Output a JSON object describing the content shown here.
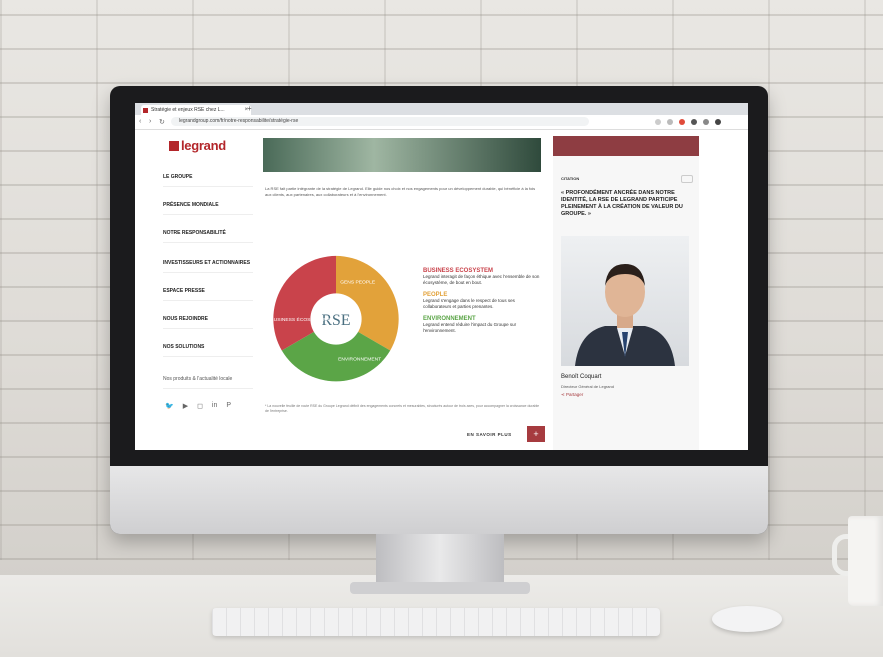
{
  "browser": {
    "tab_title": "Stratégie et enjeux RSE chez L...",
    "tab_close": "×",
    "new_tab": "+",
    "url": "legrandgroup.com/fr/notre-responsabilite/stratégie-rse"
  },
  "sidebar": {
    "logo_text": "legrand",
    "items": [
      {
        "label": "LE GROUPE"
      },
      {
        "label": "PRÉSENCE MONDIALE"
      },
      {
        "label": "NOTRE RESPONSABILITÉ"
      },
      {
        "label": "INVESTISSEURS ET ACTIONNAIRES"
      },
      {
        "label": "ESPACE PRESSE"
      },
      {
        "label": "NOUS REJOINDRE"
      },
      {
        "label": "NOS SOLUTIONS"
      }
    ],
    "products_link": "Nos produits & l'actualité locale",
    "social_icons": [
      "twitter-icon",
      "youtube-icon",
      "instagram-icon",
      "linkedin-icon",
      "pinterest-icon"
    ]
  },
  "main": {
    "intro": "La RSE fait partie intégrante de la stratégie de Legrand. Elle guide nos choix et nos engagements pour un développement durable, qui bénéficie à la fois aux clients, aux partenaires, aux collaborateurs et à l'environnement.",
    "wheel": {
      "center": "RSE",
      "segments": [
        {
          "label": "BUSINESS ÉCOSYSTÈME",
          "color": "#c9434b"
        },
        {
          "label": "GENS PEOPLE",
          "color": "#e2a23a"
        },
        {
          "label": "ENVIRONNEMENT",
          "color": "#5ba547"
        }
      ]
    },
    "legend": [
      {
        "title": "BUSINESS ECOSYSTEM",
        "text": "Legrand interagit de façon éthique avec l'ensemble de son écosystème, de bout en bout.",
        "color": "#c9434b"
      },
      {
        "title": "PEOPLE",
        "text": "Legrand s'engage dans le respect de tous ses collaborateurs et parties prenantes.",
        "color": "#e2a23a"
      },
      {
        "title": "ENVIRONNEMENT",
        "text": "Legrand entend réduire l'impact du Groupe sur l'environnement.",
        "color": "#5ba547"
      }
    ],
    "footnote": "* La nouvelle feuille de route RSE du Groupe Legrand définit des engagements concrets et mesurables, structurés autour de trois axes, pour accompagner la croissance durable de l'entreprise.",
    "more_label": "EN SAVOIR PLUS",
    "more_button": "+"
  },
  "right": {
    "section_label": "CITATION",
    "quote": "« PROFONDÉMENT ANCRÉE DANS NOTRE IDENTITÉ, LA RSE DE LEGRAND PARTICIPE PLEINEMENT À LA CRÉATION DE VALEUR DU GROUPE. »",
    "person_name": "Benoît Coquart",
    "person_title": "Directeur Général de Legrand",
    "share_label": "Partager"
  }
}
